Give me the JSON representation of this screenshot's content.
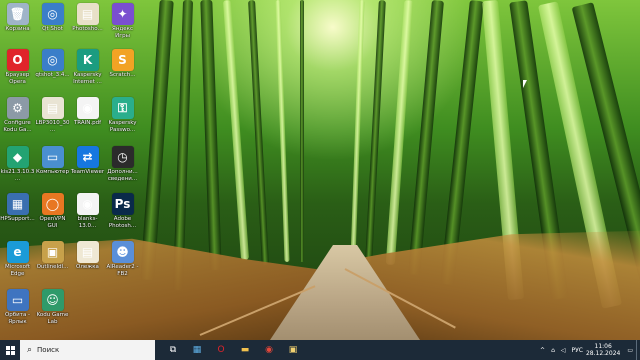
{
  "desktop_icons": [
    {
      "label": "Корзина",
      "icon": "recycle-bin-icon",
      "color": "#9fb4c8",
      "glyph": "🗑"
    },
    {
      "label": "Qt Shot",
      "icon": "qt-shot-icon",
      "color": "#3b7ec9",
      "glyph": "◎"
    },
    {
      "label": "Photosho...",
      "icon": "file-icon",
      "color": "#e8e0c8",
      "glyph": "▤"
    },
    {
      "label": "Яндекс Игры",
      "icon": "yandex-games-icon",
      "color": "#7a4fd0",
      "glyph": "✦"
    },
    {
      "label": "Браузер Opera",
      "icon": "opera-icon",
      "color": "#e0242b",
      "glyph": "O"
    },
    {
      "label": "qtshot_3.4...",
      "icon": "qt-shot-installer-icon",
      "color": "#3b7ec9",
      "glyph": "◎"
    },
    {
      "label": "Kaspersky Internet ...",
      "icon": "kaspersky-icon",
      "color": "#1b9c80",
      "glyph": "K"
    },
    {
      "label": "Scratch...",
      "icon": "scratch-icon",
      "color": "#f2a324",
      "glyph": "S"
    },
    {
      "label": "Configure Kodu Ga...",
      "icon": "kodu-config-icon",
      "color": "#8c9aa6",
      "glyph": "⚙"
    },
    {
      "label": "LBP3010_30...",
      "icon": "document-icon",
      "color": "#e9e4d4",
      "glyph": "▤"
    },
    {
      "label": "TRAIN.pdf",
      "icon": "pdf-icon",
      "color": "#f4f4f4",
      "glyph": "◉"
    },
    {
      "label": "Kaspersky Passwo...",
      "icon": "kaspersky-password-icon",
      "color": "#2aae8c",
      "glyph": "⚿"
    },
    {
      "label": "kis21.3.10.3...",
      "icon": "kaspersky-installer-icon",
      "color": "#23a372",
      "glyph": "◆"
    },
    {
      "label": "Компьютер",
      "icon": "computer-icon",
      "color": "#4a8fd0",
      "glyph": "▭"
    },
    {
      "label": "TeamViewer",
      "icon": "teamviewer-icon",
      "color": "#1677e0",
      "glyph": "⇄"
    },
    {
      "label": "Дополни... сведени...",
      "icon": "clock-icon",
      "color": "#2b2b2b",
      "glyph": "◷"
    },
    {
      "label": "HPSupport...",
      "icon": "hp-support-icon",
      "color": "#3a6fb0",
      "glyph": "▦"
    },
    {
      "label": "OpenVPN GUI",
      "icon": "openvpn-icon",
      "color": "#e87722",
      "glyph": "◯"
    },
    {
      "label": "blanks-13.0...",
      "icon": "chrome-file-icon",
      "color": "#f4f4f4",
      "glyph": "◉"
    },
    {
      "label": "Adobe Photosh...",
      "icon": "photoshop-icon",
      "color": "#0a2a4a",
      "glyph": "Ps"
    },
    {
      "label": "Microsoft Edge",
      "icon": "edge-icon",
      "color": "#1b9bd7",
      "glyph": "e"
    },
    {
      "label": "OutlineIdl...",
      "icon": "image-file-icon",
      "color": "#c7a14a",
      "glyph": "▣"
    },
    {
      "label": "Олежка",
      "icon": "text-file-icon",
      "color": "#efe8d4",
      "glyph": "▤"
    },
    {
      "label": "AlReader2 - FB2",
      "icon": "alreader-icon",
      "color": "#5a8fd8",
      "glyph": "☻"
    },
    {
      "label": "Орбита - Ярлык",
      "icon": "orbita-icon",
      "color": "#3f74c0",
      "glyph": "▭"
    },
    {
      "label": "Kodu Game Lab",
      "icon": "kodu-icon",
      "color": "#2f9a6a",
      "glyph": "☺"
    }
  ],
  "taskbar": {
    "search_placeholder": "Поиск",
    "pinned": [
      {
        "name": "task-view-icon",
        "glyph": "⧉",
        "color": "#ffffff"
      },
      {
        "name": "calculator-icon",
        "glyph": "▦",
        "color": "#5fb0e6"
      },
      {
        "name": "opera-taskbar-icon",
        "glyph": "O",
        "color": "#e0242b"
      },
      {
        "name": "file-explorer-icon",
        "glyph": "▬",
        "color": "#f2c14e"
      },
      {
        "name": "chrome-icon",
        "glyph": "◉",
        "color": "#e5473a"
      },
      {
        "name": "image-viewer-icon",
        "glyph": "▣",
        "color": "#f0d070"
      }
    ],
    "tray": {
      "chevron": "^",
      "language": "РУС",
      "time": "11:06",
      "date": "28.12.2024"
    }
  }
}
